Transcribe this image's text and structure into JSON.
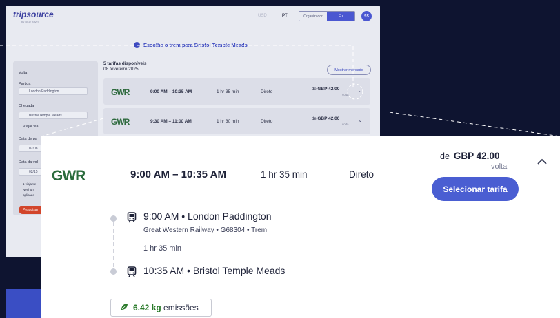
{
  "header": {
    "logo": "tripsource",
    "logo_sub": "by BCD travel",
    "currency": "USD",
    "language": "PT",
    "toggle": [
      "Organizador",
      "Eu"
    ],
    "avatar": "SS"
  },
  "banner": "Escolha o trem para Bristol Temple Meads",
  "sidebar": {
    "trip_type": "Volta",
    "departure_label": "Partida",
    "departure_value": "London Paddington",
    "arrival_label": "Chegada",
    "arrival_value": "Bristol Temple Meads",
    "via_label": "Viajar via",
    "date_label_1": "Data de pa",
    "date_value_1": "02/08",
    "date_label_2": "Data da vol",
    "date_value_2": "02/15",
    "travellers": "1 viajante",
    "note_1": "Nenhum",
    "note_2": "aplicado",
    "search_button": "Pesquisar"
  },
  "results": {
    "count_label": "5 tarifas disponíveis",
    "date_label": "08 fevereiro 2025",
    "map_button": "Mostrar mercado",
    "rows": [
      {
        "operator": "GWR",
        "time": "9:00 AM – 10:35 AM",
        "duration": "1 hr 35 min",
        "stops": "Direto",
        "price_prefix": "de",
        "price": "GBP 42.00",
        "direction": "volta"
      },
      {
        "operator": "GWR",
        "time": "9:30 AM – 11:00 AM",
        "duration": "1 hr 30 min",
        "stops": "Direto",
        "price_prefix": "de",
        "price": "GBP 42.00",
        "direction": "volta"
      }
    ]
  },
  "detail": {
    "operator": "GWR",
    "time": "9:00 AM – 10:35 AM",
    "duration": "1 hr 35 min",
    "stops": "Direto",
    "price_prefix": "de",
    "price": "GBP 42.00",
    "direction": "volta",
    "select_button": "Selecionar tarifa",
    "departure": "9:00 AM • London Paddington",
    "service": "Great Western Railway • G68304 • Trem",
    "leg_duration": "1 hr 35 min",
    "arrival": "10:35 AM • Bristol Temple Meads",
    "emissions_value": "6.42 kg",
    "emissions_label": "emissões"
  },
  "icons": {
    "collapse": "chevron-up-icon",
    "expand": "chevron-down-icon",
    "train": "train-icon",
    "leaf": "leaf-icon",
    "location": "location-pin-icon",
    "calendar": "calendar-icon"
  },
  "colors": {
    "background": "#0e1430",
    "accent": "#4a5ed2",
    "gwr_green": "#2a6b3c",
    "search_red": "#d2452b",
    "emissions_green": "#2a7a2a"
  }
}
